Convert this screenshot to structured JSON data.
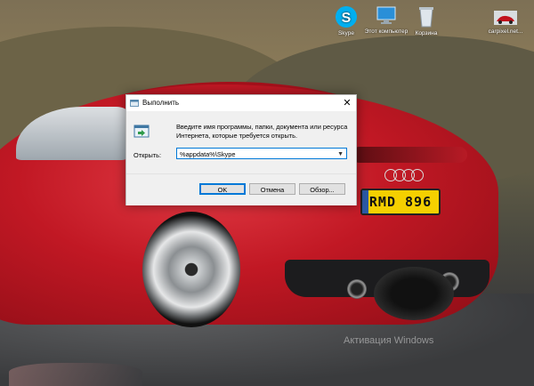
{
  "desktop": {
    "icons": [
      {
        "label": "Skype",
        "icon": "skype-icon"
      },
      {
        "label": "Этот компьютер",
        "icon": "computer-icon"
      },
      {
        "label": "Корзина",
        "icon": "recycle-bin-icon"
      },
      {
        "label": "carpixel.net...",
        "icon": "image-file-icon"
      }
    ],
    "watermark": "Активация Windows",
    "plate_text": "RMD 896"
  },
  "run_dialog": {
    "title": "Выполнить",
    "description": "Введите имя программы, папки, документа или ресурса Интернета, которые требуется открыть.",
    "open_label": "Открыть:",
    "open_value": "%appdata%\\Skype",
    "buttons": {
      "ok": "OK",
      "cancel": "Отмена",
      "browse": "Обзор..."
    },
    "close_glyph": "✕",
    "accent": "#0078d7"
  }
}
